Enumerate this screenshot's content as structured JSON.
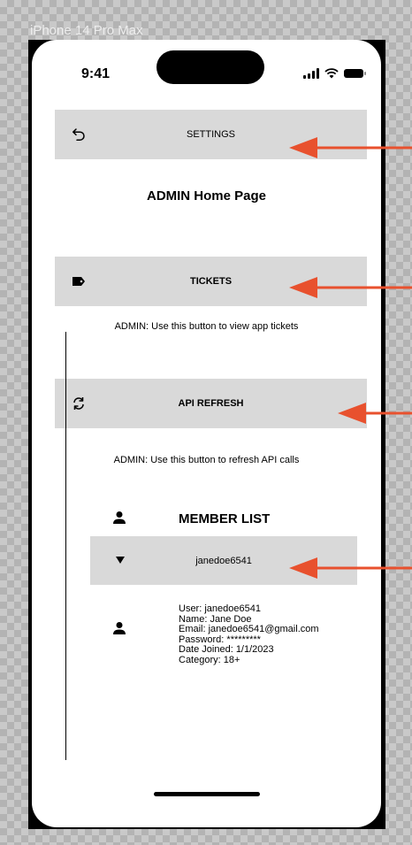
{
  "frame_label": "iPhone 14 Pro Max",
  "status_bar": {
    "time": "9:41"
  },
  "settings_bar": {
    "label": "SETTINGS",
    "icon": "undo-icon"
  },
  "page_title": "ADMIN Home Page",
  "tickets_bar": {
    "label": "TICKETS",
    "icon": "tag-icon",
    "hint": "ADMIN: Use this button to view app tickets"
  },
  "api_refresh_bar": {
    "label": "API REFRESH",
    "icon": "refresh-icon",
    "hint": "ADMIN: Use this button to refresh API calls"
  },
  "member_list": {
    "title": "MEMBER LIST",
    "selected_member": "janedoe6541",
    "details": [
      "User: janedoe6541",
      "Name: Jane Doe",
      "Email: janedoe6541@gmail.com",
      "Password: *********",
      "Date Joined: 1/1/2023",
      "Category: 18+"
    ]
  },
  "annotation_color": "#e8512e"
}
